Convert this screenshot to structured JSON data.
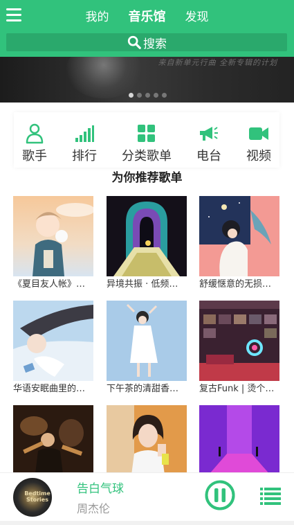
{
  "header": {
    "tabs": [
      {
        "label": "我的",
        "active": false
      },
      {
        "label": "音乐馆",
        "active": true
      },
      {
        "label": "发现",
        "active": false
      }
    ],
    "search_label": "搜索",
    "accent_color": "#31c27c"
  },
  "banner": {
    "text": "来自新单元行曲 全新专辑的计划",
    "dots_total": 5,
    "dots_active": 1
  },
  "categories": [
    {
      "label": "歌手",
      "icon": "person-icon"
    },
    {
      "label": "排行",
      "icon": "signal-bars-icon"
    },
    {
      "label": "分类歌单",
      "icon": "grid-icon"
    },
    {
      "label": "电台",
      "icon": "megaphone-icon"
    },
    {
      "label": "视频",
      "icon": "video-camera-icon"
    }
  ],
  "section_title": "为你推荐歌单",
  "playlists": [
    {
      "title": "《夏目友人帐》…"
    },
    {
      "title": "异境共振 · 低频…"
    },
    {
      "title": "舒缓惬意的无损…"
    },
    {
      "title": "华语安眠曲里的…"
    },
    {
      "title": "下午茶的清甜香…"
    },
    {
      "title": "复古Funk | 烫个…"
    },
    {
      "title": ""
    },
    {
      "title": ""
    },
    {
      "title": ""
    }
  ],
  "player": {
    "song": "告白气球",
    "singer": "周杰伦",
    "album_art_text": "Bedtime Stories",
    "state": "playing"
  }
}
